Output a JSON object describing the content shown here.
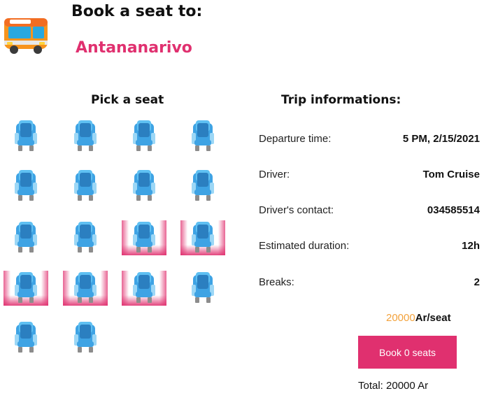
{
  "header": {
    "title": "Book a seat to:",
    "destination": "Antananarivo"
  },
  "seats": {
    "title": "Pick a seat",
    "rows": [
      [
        "available",
        "available",
        "available",
        "available"
      ],
      [
        "available",
        "available",
        "available",
        "available"
      ],
      [
        "available",
        "available",
        "taken",
        "taken"
      ],
      [
        "taken",
        "taken",
        "taken",
        "available"
      ],
      [
        "available",
        "available"
      ]
    ]
  },
  "trip": {
    "title": "Trip informations:",
    "rows": [
      {
        "label": "Departure time:",
        "value": "5 PM, 2/15/2021"
      },
      {
        "label": "Driver:",
        "value": "Tom Cruise"
      },
      {
        "label": "Driver's contact:",
        "value": "034585514"
      },
      {
        "label": "Estimated duration:",
        "value": "12h"
      },
      {
        "label": "Breaks:",
        "value": "2"
      }
    ]
  },
  "pricing": {
    "amount": "20000",
    "unit": "Ar/seat",
    "book_label": "Book 0 seats",
    "total": "Total: 20000 Ar"
  },
  "colors": {
    "accent": "#e0306f",
    "price": "#f3a23c",
    "seat_blue": "#3ea3e4"
  }
}
